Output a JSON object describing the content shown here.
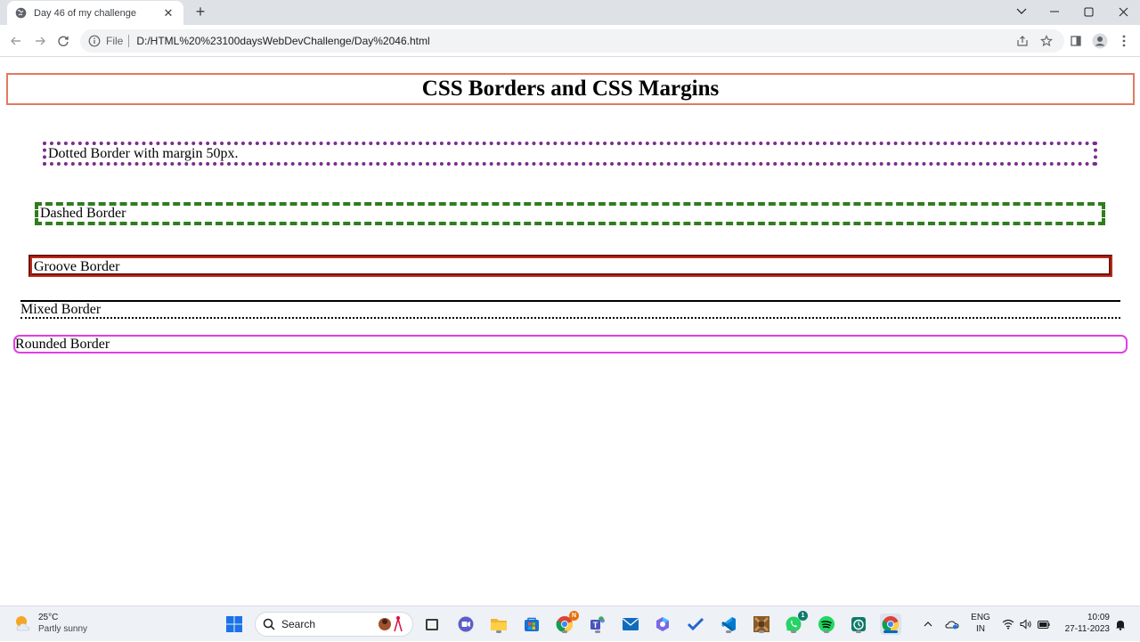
{
  "browser": {
    "tab_title": "Day 46 of my challenge",
    "new_tab_symbol": "+",
    "url_scheme": "File",
    "url": "D:/HTML%20%23100daysWebDevChallenge/Day%2046.html",
    "window_controls": [
      "chevron-down-icon",
      "minimize-icon",
      "maximize-icon",
      "close-icon"
    ],
    "toolbar_icons": [
      "back-icon",
      "forward-icon",
      "reload-icon",
      "share-icon",
      "star-icon",
      "side-panel-icon",
      "profile-icon",
      "menu-icon"
    ]
  },
  "page": {
    "heading": "CSS Borders and CSS Margins",
    "boxes": {
      "dotted": "Dotted Border with margin 50px.",
      "dashed": "Dashed Border",
      "groove": "Groove Border",
      "mixed": "Mixed Border",
      "rounded": "Rounded Border"
    },
    "colors": {
      "heading_border": "#e07a5f",
      "dotted_border": "#7b2d8e",
      "dashed_border": "#2f7d1f",
      "groove_border": "#c0281b",
      "rounded_border": "#e040e0"
    }
  },
  "taskbar": {
    "weather": {
      "temp": "25°C",
      "condition": "Partly sunny"
    },
    "search_label": "Search",
    "apps": [
      "windows-start-icon",
      "search-icon",
      "widgets-icon",
      "file-manager-icon",
      "teams-chat-icon",
      "file-explorer-icon",
      "store-icon",
      "chrome-icon",
      "teams-icon",
      "mail-icon",
      "copilot-icon",
      "todo-icon",
      "vscode-icon",
      "minecraft-icon",
      "whatsapp-icon",
      "spotify-icon",
      "clock-app-icon",
      "chrome-active-icon"
    ],
    "badges": {
      "chrome": "N",
      "whatsapp": "1"
    },
    "language": {
      "line1": "ENG",
      "line2": "IN"
    },
    "clock": {
      "time": "10:09",
      "date": "27-11-2023"
    }
  }
}
